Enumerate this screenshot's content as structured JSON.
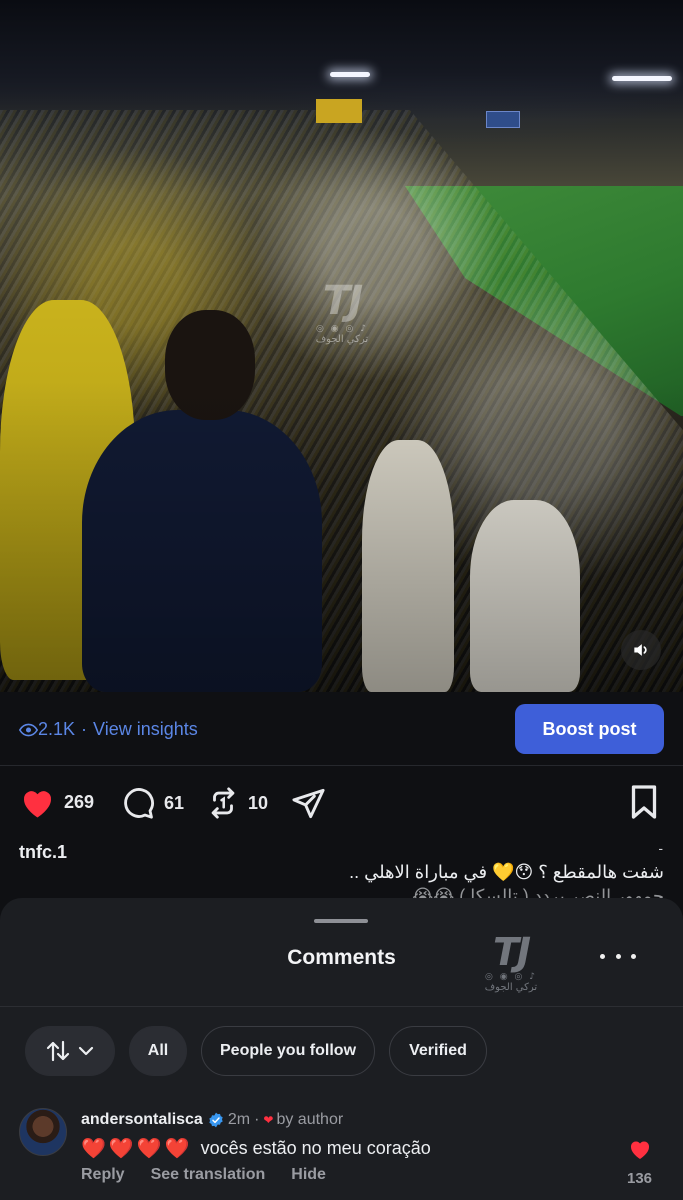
{
  "post": {
    "views": "2.1K",
    "view_insights": "View insights",
    "separator": "·",
    "boost_label": "Boost post",
    "likes": "269",
    "comments": "61",
    "reposts": "10",
    "username": "tnfc.1",
    "caption_dash": "-",
    "caption_line1": "شفت هالمقطع ؟ 😯💛 في مباراة الاهلي ..",
    "caption_line2": "جمهور النصر يردد ( تالسكا ) 😭😭"
  },
  "watermark": {
    "mark": "TJ",
    "socials": "◎ ◉ ◎ ♪",
    "name": "تركي الجوف"
  },
  "sheet": {
    "title": "Comments",
    "filters": {
      "all": "All",
      "people_you_follow": "People you follow",
      "verified": "Verified"
    }
  },
  "comment": {
    "username": "andersontalisca",
    "time": "2m",
    "separator": "·",
    "by_author": "by author",
    "emoji": "❤️❤️❤️❤️",
    "text": "vocês estão no meu coração",
    "reply": "Reply",
    "see_translation": "See translation",
    "hide": "Hide",
    "like_count": "136"
  },
  "colors": {
    "accent_blue": "#3e5fd9",
    "link_blue": "#5b86e5",
    "heart_red": "#ff3040",
    "verified_blue": "#3897f0"
  },
  "icons": [
    "eye-icon",
    "heart-icon",
    "comment-icon",
    "repost-icon",
    "share-icon",
    "bookmark-icon",
    "sound-icon",
    "sort-icon",
    "chevron-down-icon",
    "more-icon",
    "verified-icon"
  ]
}
